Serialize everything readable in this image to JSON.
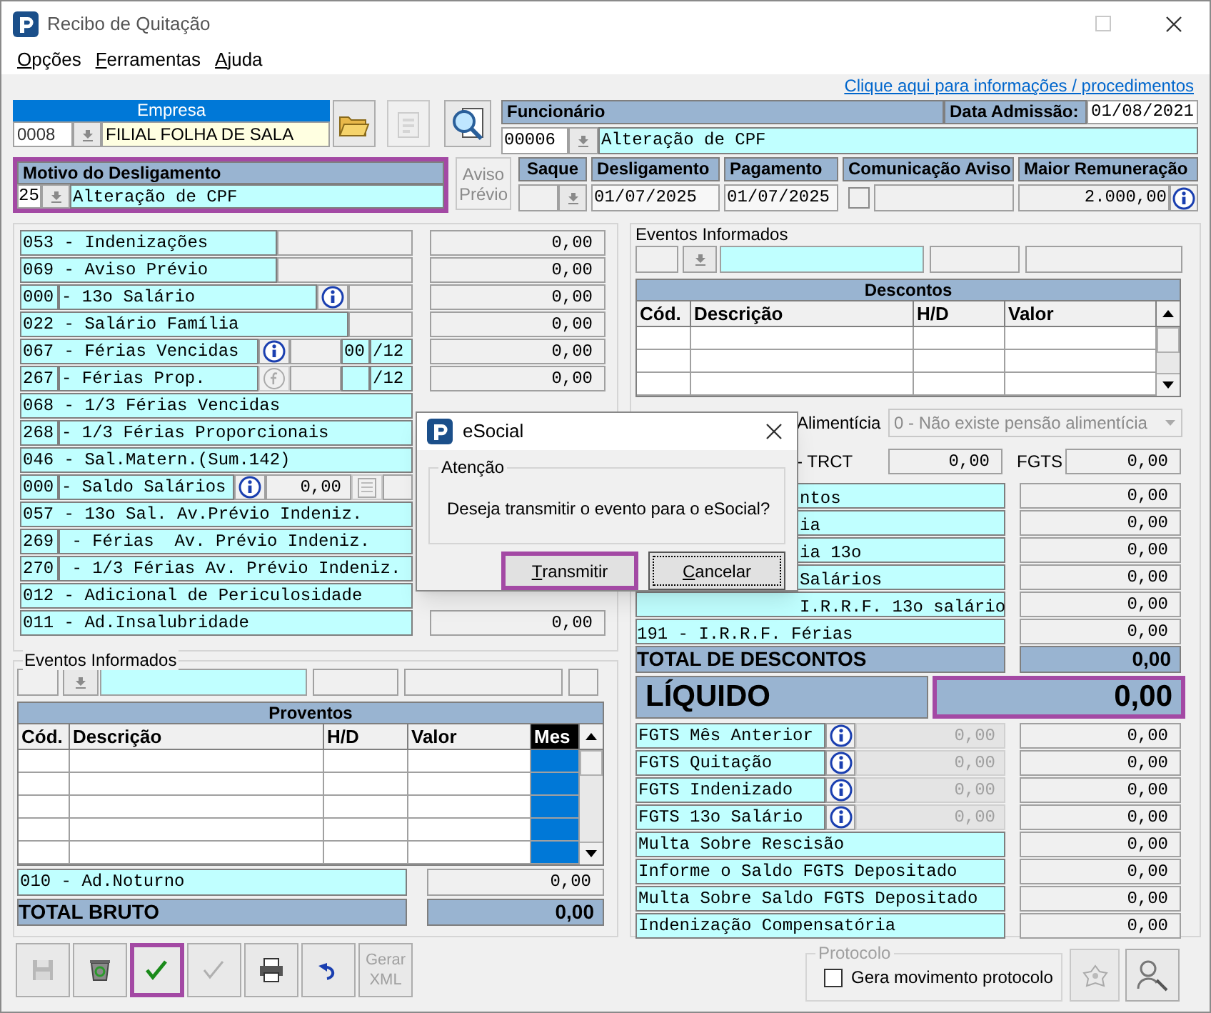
{
  "window": {
    "title": "Recibo de Quitação"
  },
  "menu": [
    {
      "label": "Opções"
    },
    {
      "label": "Ferramentas"
    },
    {
      "label": "Ajuda"
    }
  ],
  "help_link": "Clique aqui para informações / procedimentos",
  "empresa": {
    "label": "Empresa",
    "code": "0008",
    "name": "FILIAL FOLHA DE SALA"
  },
  "toolbar_top": [
    {
      "kind": "open",
      "disabled": false
    },
    {
      "kind": "report",
      "disabled": true
    },
    {
      "kind": "search",
      "disabled": false
    }
  ],
  "funcionario": {
    "label": "Funcionário",
    "code": "00006",
    "name": "Alteração de CPF",
    "admission_label": "Data Admissão:",
    "admission_date": "01/08/2021"
  },
  "motivo": {
    "label": "Motivo do Desligamento",
    "code": "25",
    "description": "Alteração de CPF",
    "highlighted": true
  },
  "aviso_previo_button": {
    "label": "Aviso Prévio",
    "disabled": true
  },
  "saque": {
    "label": "Saque"
  },
  "desligamento": {
    "label": "Desligamento",
    "value": "01/07/2025"
  },
  "pagamento": {
    "label": "Pagamento",
    "value": "01/07/2025"
  },
  "comunicacao_aviso": {
    "label": "Comunicação Aviso",
    "checked": false
  },
  "maior_remuneracao": {
    "label": "Maior Remuneração",
    "value": "2.000,00"
  },
  "verbas": [
    {
      "kind": "single",
      "label": "053 - Indenizações",
      "extras": [
        {
          "kind": "blank_wide"
        }
      ],
      "value": "0,00"
    },
    {
      "kind": "single",
      "label": "069 - Aviso Prévio",
      "extras": [
        {
          "kind": "blank_wide"
        }
      ],
      "value": "0,00"
    },
    {
      "kind": "split",
      "code": "000",
      "label": "- 13o Salário",
      "extras": [
        {
          "kind": "info"
        },
        {
          "kind": "blank"
        }
      ],
      "value": "0,00"
    },
    {
      "kind": "single",
      "label": "022 - Salário Família",
      "extras": [
        {
          "kind": "blank"
        }
      ],
      "value": "0,00"
    },
    {
      "kind": "single",
      "label": "067 - Férias Vencidas",
      "extras": [
        {
          "kind": "info"
        },
        {
          "kind": "blank_short"
        },
        {
          "kind": "count",
          "text": "00"
        },
        {
          "kind": "months",
          "text": "/12"
        }
      ],
      "value": "0,00"
    },
    {
      "kind": "split",
      "code": "267",
      "label": "- Férias Prop.",
      "extras": [
        {
          "kind": "f_icon"
        },
        {
          "kind": "blank_short"
        },
        {
          "kind": "count"
        },
        {
          "kind": "months",
          "text": "/12"
        }
      ],
      "value": "0,00"
    },
    {
      "kind": "single",
      "label": "068 - 1/3 Férias Vencidas"
    },
    {
      "kind": "split",
      "code": "268",
      "label": "- 1/3 Férias Proporcionais"
    },
    {
      "kind": "single",
      "label": "046 - Sal.Matern.(Sum.142)"
    },
    {
      "kind": "split",
      "code": "000",
      "label": "- Saldo Salários",
      "extras": [
        {
          "kind": "info"
        },
        {
          "kind": "amount",
          "text": "0,00"
        },
        {
          "kind": "calc"
        },
        {
          "kind": "blank_tiny"
        }
      ]
    },
    {
      "kind": "single",
      "label": "057 - 13o Sal. Av.Prévio Indeniz."
    },
    {
      "kind": "split",
      "code": "269",
      "label": " - Férias  Av. Prévio Indeniz."
    },
    {
      "kind": "split",
      "code": "270",
      "label": " - 1/3 Férias Av. Prévio Indeniz."
    },
    {
      "kind": "single",
      "label": "012 - Adicional de Periculosidade"
    },
    {
      "kind": "single",
      "label": "011 - Ad.Insalubridade",
      "value": "0,00"
    }
  ],
  "eventos_descontos": {
    "legend": "Eventos Informados"
  },
  "descontos": {
    "title": "Descontos",
    "columns": [
      {
        "label": "Cód.",
        "selected": false
      },
      {
        "label": "Descrição",
        "selected": false
      },
      {
        "label": "H/D",
        "selected": false
      },
      {
        "label": "Valor",
        "selected": false
      }
    ]
  },
  "pensao": {
    "label": "Alimentícia",
    "value": "0 - Não existe pensão alimentícia",
    "disabled": true
  },
  "trct": {
    "label": "- TRCT",
    "value": "0,00",
    "fgts_label": "FGTS",
    "fgts_value": "0,00"
  },
  "descontos_rows": [
    {
      "label": "ntos",
      "value": "0,00",
      "partial": true
    },
    {
      "label": "ia",
      "value": "0,00",
      "partial": true
    },
    {
      "label": "ia 13o",
      "value": "0,00",
      "partial": true
    },
    {
      "label": "Salários",
      "value": "0,00",
      "partial": true
    },
    {
      "label": "I.R.R.F. 13o salário",
      "value": "0,00",
      "partial": true
    },
    {
      "label": "191 - I.R.R.F. Férias",
      "value": "0,00",
      "partial": false
    }
  ],
  "total_descontos": {
    "label": "TOTAL DE DESCONTOS",
    "value": "0,00"
  },
  "liquido": {
    "label": "LÍQUIDO",
    "value": "0,00",
    "highlighted": true
  },
  "fgts_rows": [
    {
      "label": "FGTS Mês Anterior",
      "base": "0,00",
      "value": "0,00"
    },
    {
      "label": "FGTS Quitação",
      "base": "0,00",
      "value": "0,00"
    },
    {
      "label": "FGTS Indenizado",
      "base": "0,00",
      "value": "0,00"
    },
    {
      "label": "FGTS 13o Salário",
      "base": "0,00",
      "value": "0,00"
    }
  ],
  "other_rows": [
    {
      "label": "Multa Sobre Rescisão",
      "value": "0,00"
    },
    {
      "label": "Informe o Saldo FGTS Depositado",
      "value": "0,00"
    },
    {
      "label": "Multa Sobre Saldo FGTS Depositado",
      "value": "0,00"
    },
    {
      "label": "Indenização Compensatória",
      "value": "0,00"
    }
  ],
  "eventos_proventos": {
    "legend": "Eventos Informados"
  },
  "proventos": {
    "title": "Proventos",
    "columns": [
      {
        "label": "Cód.",
        "selected": false
      },
      {
        "label": "Descrição",
        "selected": false
      },
      {
        "label": "H/D",
        "selected": false
      },
      {
        "label": "Valor",
        "selected": false
      },
      {
        "label": "Mes",
        "selected": true
      }
    ]
  },
  "ad_noturno": {
    "label": "010 - Ad.Noturno",
    "value": "0,00"
  },
  "total_bruto": {
    "label": "TOTAL BRUTO",
    "value": "0,00"
  },
  "toolbar": [
    {
      "kind": "save",
      "disabled": true,
      "highlighted": false
    },
    {
      "kind": "delete",
      "disabled": false,
      "highlighted": false
    },
    {
      "kind": "confirm",
      "disabled": false,
      "highlighted": true
    },
    {
      "kind": "confirm",
      "disabled": true,
      "highlighted": false
    },
    {
      "kind": "print",
      "disabled": false,
      "highlighted": false
    },
    {
      "kind": "undo",
      "disabled": false,
      "highlighted": false
    },
    {
      "kind": "xml",
      "label": "Gerar XML",
      "disabled": true,
      "highlighted": false
    }
  ],
  "protocolo": {
    "legend": "Protocolo",
    "disabled": true,
    "checkbox_label": "Gera movimento protocolo",
    "checked": false
  },
  "side_buttons": [
    {
      "kind": "process",
      "disabled": true
    },
    {
      "kind": "people_search",
      "disabled": false
    }
  ],
  "dialog": {
    "title": "eSocial",
    "group": "Atenção",
    "message": "Deseja transmitir o evento para o eSocial?",
    "buttons": [
      {
        "label": "Transmitir",
        "highlighted": true,
        "focused": false
      },
      {
        "label": "Cancelar",
        "highlighted": false,
        "focused": true
      }
    ]
  }
}
